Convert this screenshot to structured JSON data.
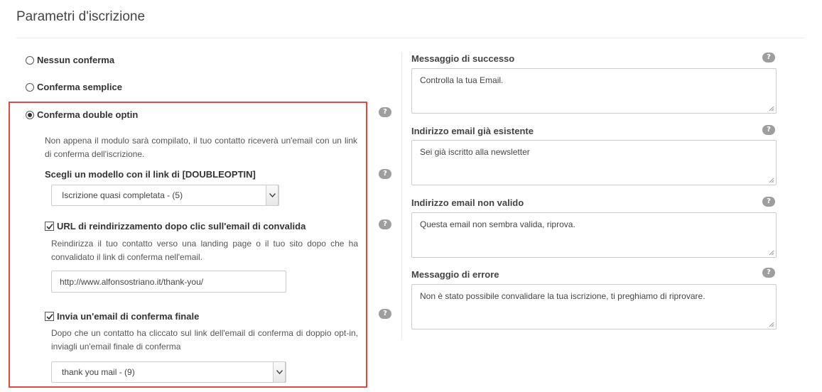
{
  "page": {
    "title": "Parametri d'iscrizione"
  },
  "options": {
    "none": "Nessun conferma",
    "simple": "Conferma semplice",
    "double": "Conferma double optin"
  },
  "double_optin": {
    "description": "Non appena il modulo sarà compilato, il tuo contatto riceverà un'email con un link di conferma dell'iscrizione.",
    "template_label": "Scegli un modello con il link di [DOUBLEOPTIN]",
    "template_selected": "Iscrizione quasi completata - (5)",
    "redirect_label": "URL di reindirizzamento dopo clic sull'email di convalida",
    "redirect_description": "Reindirizza il tuo contatto verso una landing page o il tuo sito dopo che ha convalidato il link di conferma nell'email.",
    "redirect_url": "http://www.alfonsostriano.it/thank-you/",
    "final_email_label": "Invia un'email di conferma finale",
    "final_email_description": "Dopo che un contatto ha cliccato sul link dell'email di conferma di doppio opt-in, inviagli un'email finale di conferma",
    "final_email_selected": "thank you mail - (9)"
  },
  "messages": {
    "success": {
      "label": "Messaggio di successo",
      "value": "Controlla la tua Email."
    },
    "existing": {
      "label": "Indirizzo email già esistente",
      "value": "Sei già iscritto alla newsletter"
    },
    "invalid": {
      "label": "Indirizzo email non valido",
      "value": "Questa email non sembra valida, riprova."
    },
    "error": {
      "label": "Messaggio di errore",
      "value": "Non è stato possibile convalidare la tua iscrizione, ti preghiamo di riprovare."
    }
  },
  "help_glyph": "?",
  "colors": {
    "highlight": "#e04a45",
    "help_badge": "#9e9e9e"
  }
}
